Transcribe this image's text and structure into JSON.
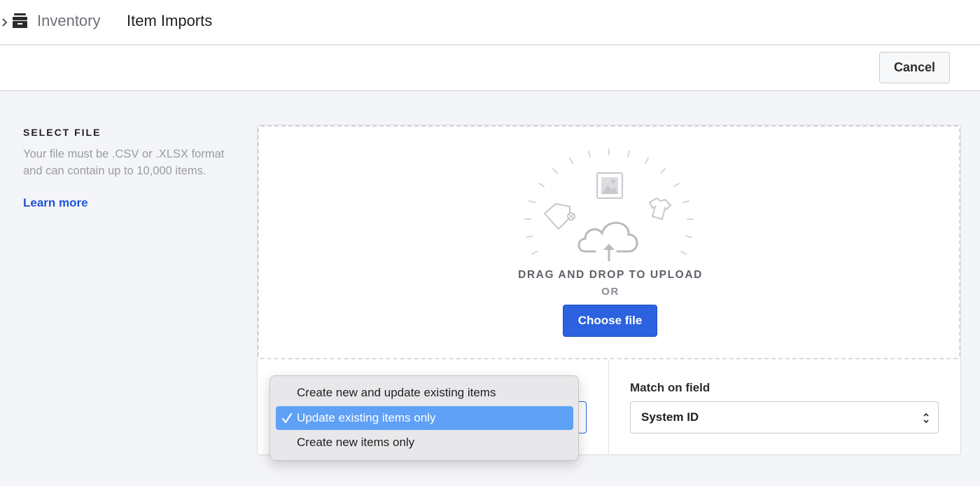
{
  "header": {
    "app_icon": "inventory-drawer-icon",
    "breadcrumb": {
      "parent": "Inventory",
      "current": "Item Imports"
    }
  },
  "actions": {
    "cancel_label": "Cancel"
  },
  "info": {
    "title": "SELECT FILE",
    "description": "Your file must be .CSV or .XLSX format and can contain up to 10,000 items.",
    "learn_more": "Learn more"
  },
  "upload": {
    "drag_text": "DRAG AND DROP TO UPLOAD",
    "or_text": "OR",
    "choose_label": "Choose file",
    "illustration_icons": [
      "image-icon",
      "tag-icon",
      "shirt-icon",
      "cloud-upload-icon"
    ]
  },
  "import_mode": {
    "options": [
      "Create new and update existing items",
      "Update existing items only",
      "Create new items only"
    ],
    "selected_index": 1
  },
  "match": {
    "label": "Match on field",
    "value": "System ID"
  },
  "colors": {
    "primary": "#2c62e0",
    "link": "#1e55d6",
    "selected_option": "#5ea1f6"
  }
}
